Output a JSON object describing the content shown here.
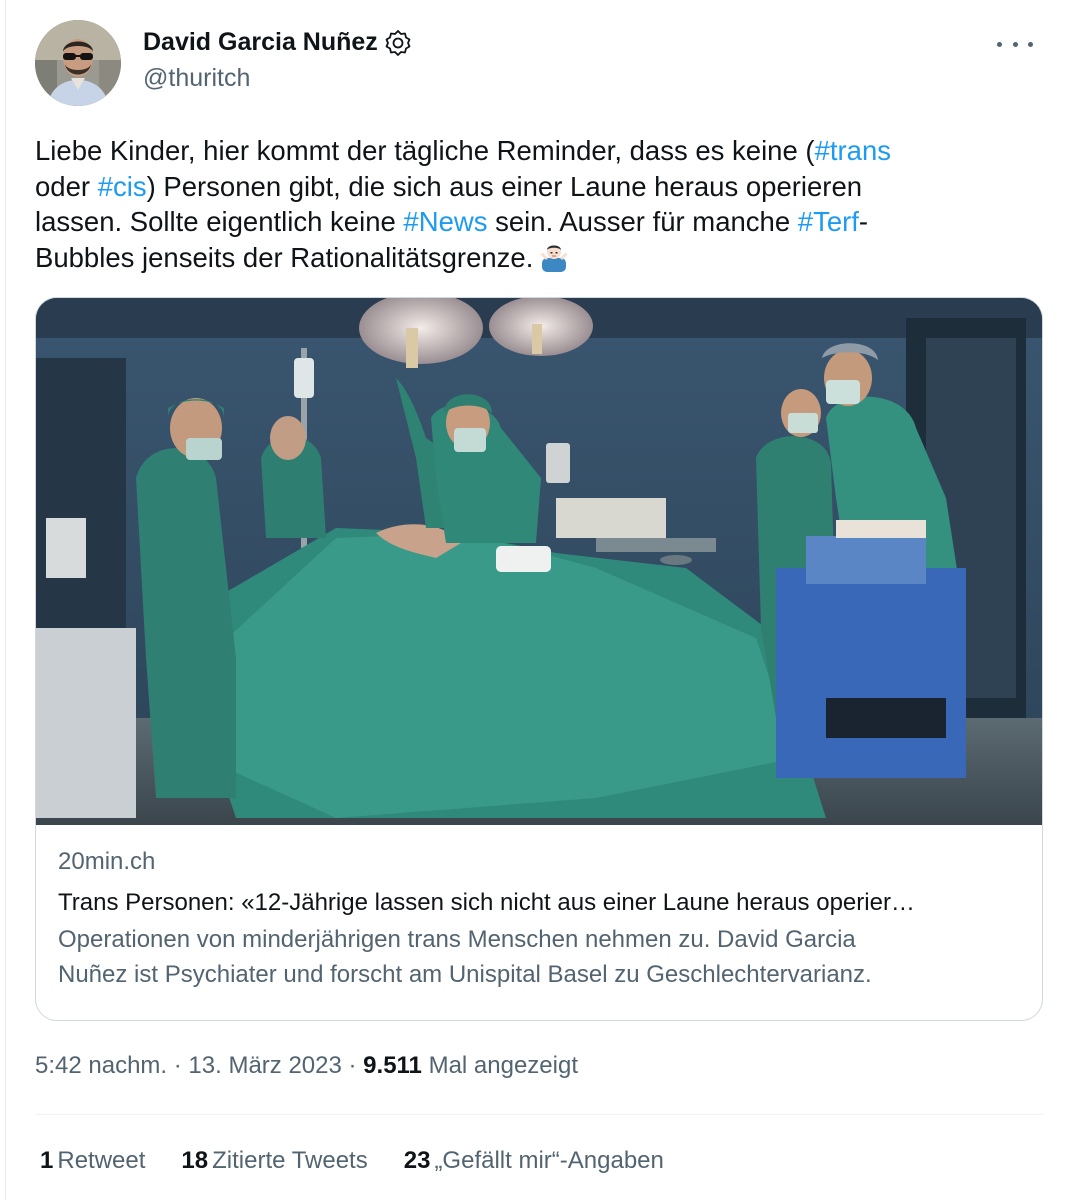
{
  "author": {
    "display_name": "David Garcia Nuñez",
    "handle": "@thuritch",
    "verified_badge_icon": "verified-gear-badge-icon",
    "avatar": "person-with-sunglasses-avatar"
  },
  "tweet": {
    "lines": [
      [
        {
          "t": "Liebe Kinder, hier kommt der tägliche Reminder, dass es keine ("
        },
        {
          "h": "#trans"
        }
      ],
      [
        {
          "t": "oder "
        },
        {
          "h": "#cis"
        },
        {
          "t": ") Personen gibt, die sich aus einer Laune heraus operieren"
        }
      ],
      [
        {
          "t": "lassen. Sollte eigentlich keine "
        },
        {
          "h": "#News"
        },
        {
          "t": " sein. Ausser für manche "
        },
        {
          "h": "#Terf"
        },
        {
          "t": "-"
        }
      ],
      [
        {
          "t": "Bubbles jenseits der Rationalitätsgrenze."
        }
      ]
    ],
    "emoji": "man-shrugging-emoji"
  },
  "card": {
    "image": "operating-room-photo",
    "domain": "20min.ch",
    "title": "Trans Personen: «12-Jährige lassen sich nicht aus einer Laune heraus operier…",
    "description_lines": [
      "Operationen von minderjährigen trans Menschen nehmen zu. David Garcia",
      "Nuñez ist Psychiater und forscht am Unispital Basel zu Geschlechtervarianz."
    ]
  },
  "meta": {
    "time": "5:42 nachm.",
    "sep1": " · ",
    "date": "13. März 2023",
    "sep2": " · ",
    "views_count": "9.511",
    "views_label": " Mal angezeigt"
  },
  "stats": [
    {
      "count": "1",
      "label": "Retweet"
    },
    {
      "count": "18",
      "label": "Zitierte Tweets"
    },
    {
      "count": "23",
      "label": "„Gefällt mir“-Angaben"
    }
  ],
  "colors": {
    "link": "#1d9bf0",
    "text": "#0f1419",
    "secondary": "#536471",
    "border": "#cfd9de"
  }
}
